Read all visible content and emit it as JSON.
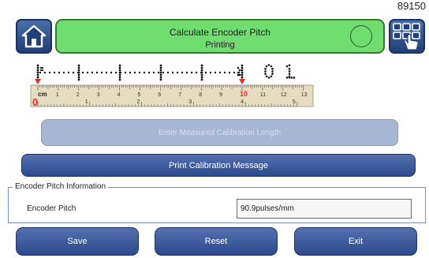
{
  "screen_code": "89150",
  "header": {
    "title": "Calculate Encoder Pitch",
    "status": "Printing",
    "status_color": "#6fdd6f"
  },
  "home_icon": "home-icon",
  "menu_icon": "grid-touch-icon",
  "ruler": {
    "dot_text": "01",
    "cm_label": "cm",
    "zero_label": "0",
    "ten_label": "10",
    "top_numbers": [
      "1",
      "2",
      "3",
      "4",
      "5",
      "6",
      "7",
      "8",
      "9",
      "10",
      "11",
      "12",
      "13"
    ],
    "bottom_numbers": [
      "1",
      "2",
      "3",
      "4",
      "5"
    ],
    "marker_color": "#e03030"
  },
  "calibration_input": {
    "placeholder": "Enter Measured Calibration Length"
  },
  "print_button": "Print Calibration Message",
  "encoder_info": {
    "legend": "Encoder Pitch Information",
    "label": "Encoder Pitch",
    "value": "90.9pulses/mm"
  },
  "buttons": {
    "save": "Save",
    "reset": "Reset",
    "exit": "Exit"
  },
  "colors": {
    "accent_blue": "#2c4a8c",
    "header_green": "#6fdd6f",
    "disabled_field": "#a6b6d3"
  }
}
